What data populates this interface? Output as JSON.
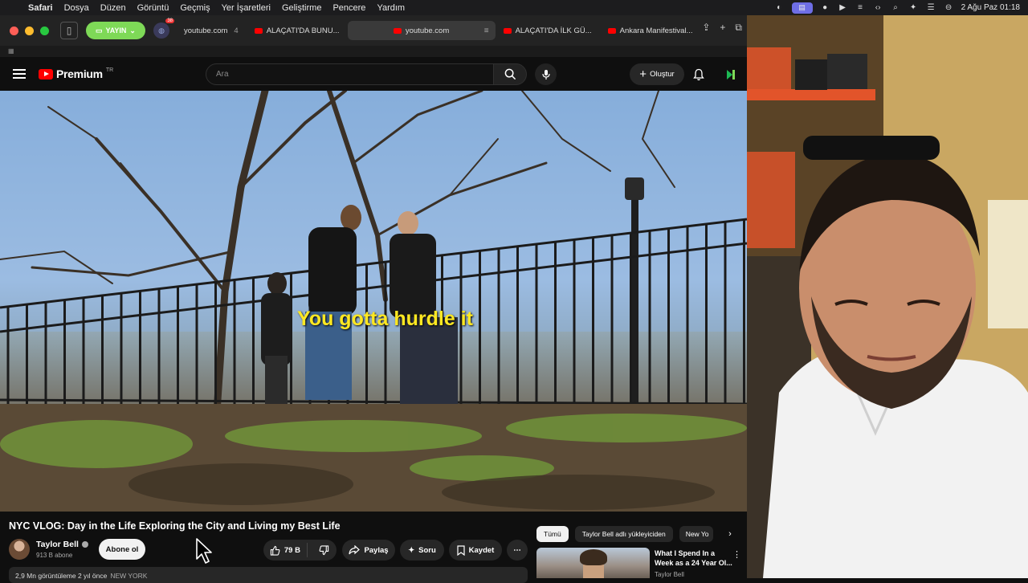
{
  "menubar": {
    "app": "Safari",
    "items": [
      "Dosya",
      "Düzen",
      "Görüntü",
      "Geçmiş",
      "Yer İşaretleri",
      "Geliştirme",
      "Pencere",
      "Yardım"
    ],
    "datetime": "2 Ağu Paz  01:18"
  },
  "browser": {
    "live_label": "YAYIN",
    "ext_badge": "38",
    "tabs": [
      {
        "label": "youtube.com",
        "count": "4",
        "active": false,
        "favicon": "none"
      },
      {
        "label": "ALAÇATI'DA BUNU...",
        "active": false,
        "favicon": "youtube-icon"
      },
      {
        "label": "youtube.com",
        "active": true,
        "favicon": "youtube-icon"
      },
      {
        "label": "ALAÇATI'DA İLK GÜ...",
        "active": false,
        "favicon": "youtube-icon"
      },
      {
        "label": "Ankara Manifestival...",
        "active": false,
        "favicon": "youtube-icon"
      }
    ]
  },
  "youtube": {
    "logo_text": "Premium",
    "logo_region": "TR",
    "search_placeholder": "Ara",
    "create_label": "Oluştur"
  },
  "video": {
    "caption": "You gotta hurdle it",
    "title": "NYC VLOG: Day in the Life Exploring the City and Living my Best Life",
    "channel": "Taylor Bell",
    "subscribers": "913 B abone",
    "subscribe_label": "Abone ol",
    "likes": "79 B",
    "share_label": "Paylaş",
    "ask_label": "Soru",
    "save_label": "Kaydet",
    "views_text": "2,9 Mn görüntüleme  2 yıl önce",
    "views_tag": "NEW YORK"
  },
  "sidebar": {
    "chips": [
      "Tümü",
      "Taylor Bell adlı yükleyiciden",
      "New Yo"
    ],
    "rec": {
      "title": "What I Spend In a Week as a 24 Year Ol...",
      "channel": "Taylor Bell"
    }
  },
  "colors": {
    "youtube_red": "#ff0000",
    "caption_yellow": "#ffe822",
    "live_green": "#7ed957"
  }
}
